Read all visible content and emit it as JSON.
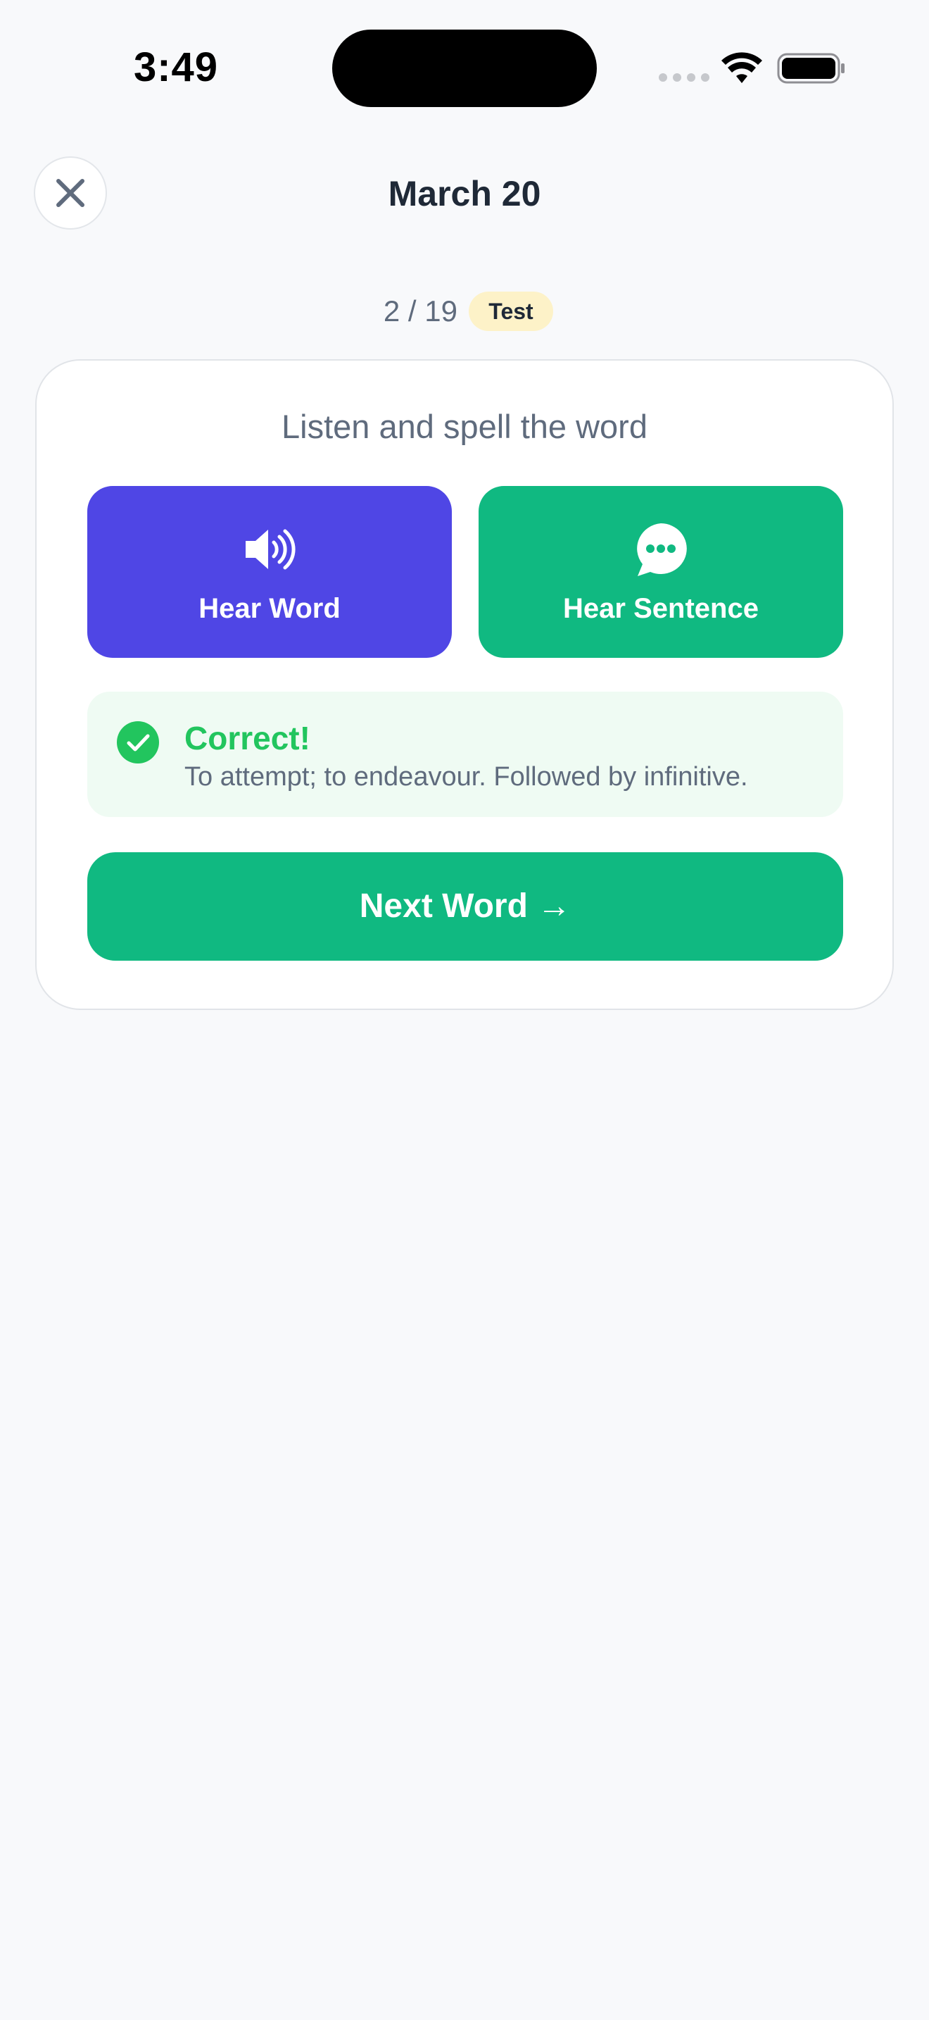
{
  "status_bar": {
    "time": "3:49"
  },
  "header": {
    "title": "March 20",
    "close_icon": "close-icon"
  },
  "progress": {
    "text": "2 / 19",
    "badge": "Test"
  },
  "card": {
    "instruction": "Listen and spell the word",
    "hear_word": {
      "label": "Hear Word",
      "icon": "speaker-icon",
      "color": "#4f46e5"
    },
    "hear_sentence": {
      "label": "Hear Sentence",
      "icon": "chat-bubble-icon",
      "color": "#10b981"
    },
    "feedback": {
      "title": "Correct!",
      "definition": "To attempt; to endeavour. Followed by infinitive.",
      "icon": "check-circle-icon",
      "color": "#22c55e"
    },
    "next_button": {
      "label": "Next Word →",
      "color": "#10b981"
    }
  }
}
